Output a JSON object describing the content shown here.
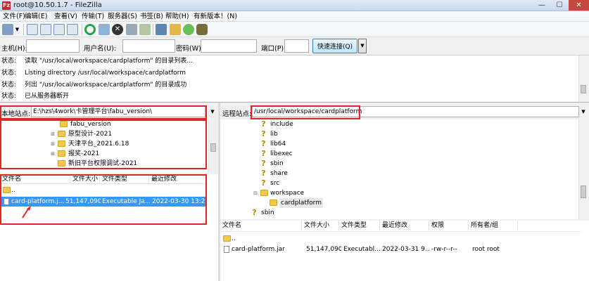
{
  "window": {
    "title": "root@10.50.1.7 - FileZilla",
    "app_icon_glyph": "Fz",
    "min_glyph": "—",
    "max_glyph": "☐",
    "close_glyph": "✕"
  },
  "menu": [
    "文件(F)",
    "编辑(E)",
    "查看(V)",
    "传输(T)",
    "服务器(S)",
    "书签(B)",
    "帮助(H)",
    "有新版本！(N)"
  ],
  "toolbar": {
    "icons": [
      "site-manager-icon",
      "dropdown-arrow-icon",
      "toggle-log-icon",
      "toggle-local-tree-icon",
      "toggle-remote-tree-icon",
      "toggle-queue-icon",
      "refresh-icon",
      "process-queue-icon",
      "cancel-icon",
      "disconnect-icon",
      "reconnect-icon",
      "filter-icon",
      "compare-icon",
      "sync-browse-icon",
      "search-icon"
    ]
  },
  "quickconnect": {
    "host_label": "主机(H):",
    "host_value": "",
    "user_label": "用户名(U):",
    "user_value": "",
    "pass_label": "密码(W):",
    "pass_value": "",
    "port_label": "端口(P):",
    "port_value": "",
    "button_label": "快速连接(Q)",
    "dropdown_glyph": "▼"
  },
  "log": [
    {
      "label": "状态:",
      "message": "读取 \"/usr/local/workspace/cardplatform\" 的目录列表..."
    },
    {
      "label": "状态:",
      "message": "Listing directory /usr/local/workspace/cardplatform"
    },
    {
      "label": "状态:",
      "message": "列出 \"/usr/local/workspace/cardplatform\" 的目录成功"
    },
    {
      "label": "状态:",
      "message": "已从服务器断开"
    }
  ],
  "local": {
    "site_label": "本地站点:",
    "site_path": "E:\\hzs\\4work\\卡管理平台\\fabu_version\\",
    "tree": [
      {
        "name": "fabu_version",
        "expander": ""
      },
      {
        "name": "原型设计-2021",
        "expander": "⊞"
      },
      {
        "name": "天津平台_2021.6.18",
        "expander": "⊞"
      },
      {
        "name": "报奖-2021",
        "expander": "⊞"
      },
      {
        "name": "新旧平台权限调试-2021",
        "expander": ""
      }
    ],
    "columns": [
      "文件名",
      "文件大小",
      "文件类型",
      "最近修改"
    ],
    "files": [
      {
        "name": "..",
        "size": "",
        "type": "",
        "modified": "",
        "icon": "folder"
      },
      {
        "name": "card-platform.j...",
        "size": "51,147,090",
        "type": "Executable Ja...",
        "modified": "2022-03-30 13:2...",
        "icon": "file"
      }
    ]
  },
  "remote": {
    "site_label": "远程站点:",
    "site_path": "/usr/local/workspace/cardplatform",
    "tree": [
      {
        "name": "include",
        "kind": "unknown",
        "depth": 1,
        "expander": ""
      },
      {
        "name": "lib",
        "kind": "unknown",
        "depth": 1,
        "expander": ""
      },
      {
        "name": "lib64",
        "kind": "unknown",
        "depth": 1,
        "expander": ""
      },
      {
        "name": "libexec",
        "kind": "unknown",
        "depth": 1,
        "expander": ""
      },
      {
        "name": "sbin",
        "kind": "unknown",
        "depth": 1,
        "expander": ""
      },
      {
        "name": "share",
        "kind": "unknown",
        "depth": 1,
        "expander": ""
      },
      {
        "name": "src",
        "kind": "unknown",
        "depth": 1,
        "expander": ""
      },
      {
        "name": "workspace",
        "kind": "folder",
        "depth": 1,
        "expander": "⊟"
      },
      {
        "name": "cardplatform",
        "kind": "folder",
        "depth": 2,
        "expander": ""
      },
      {
        "name": "sbin",
        "kind": "unknown",
        "depth": 0,
        "expander": ""
      }
    ],
    "columns": [
      "文件名",
      "文件大小",
      "文件类型",
      "最近修改",
      "权限",
      "所有者/组"
    ],
    "files": [
      {
        "name": "..",
        "size": "",
        "type": "",
        "modified": "",
        "perms": "",
        "owner": "",
        "icon": "folder"
      },
      {
        "name": "card-platform.jar",
        "size": "51,147,090",
        "type": "Executabl...",
        "modified": "2022-03-31 9...",
        "perms": "-rw-r--r--",
        "owner": "root root",
        "icon": "file"
      }
    ]
  },
  "colors": {
    "highlight": "#e0262b",
    "selection": "#3399ff",
    "folder": "#f2c94c"
  }
}
